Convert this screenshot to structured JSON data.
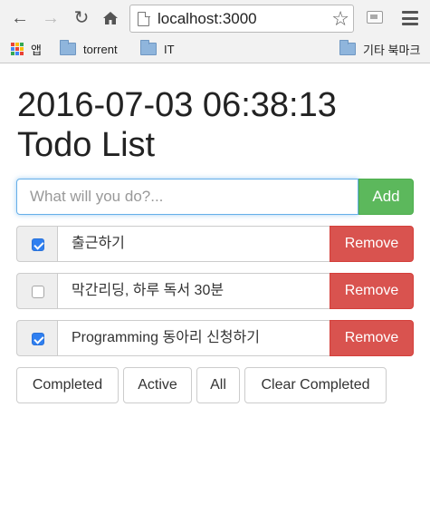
{
  "browser": {
    "url": "localhost:3000",
    "bookmarks": [
      {
        "label": "앱",
        "icon": "apps-grid-icon"
      },
      {
        "label": "torrent",
        "icon": "folder-icon"
      },
      {
        "label": "IT",
        "icon": "folder-icon"
      },
      {
        "label": "기타 북마크",
        "icon": "folder-icon"
      }
    ]
  },
  "app": {
    "title_line1": "2016-07-03 06:38:13",
    "title_line2": "Todo List",
    "input_placeholder": "What will you do?...",
    "input_value": "",
    "add_label": "Add",
    "remove_label": "Remove",
    "todos": [
      {
        "text": "출근하기",
        "completed": true
      },
      {
        "text": "막간리딩, 하루 독서 30분",
        "completed": false
      },
      {
        "text": "Programming 동아리 신청하기",
        "completed": true
      }
    ],
    "filters": [
      "Completed",
      "Active",
      "All",
      "Clear Completed"
    ]
  },
  "colors": {
    "add_button": "#5cb85c",
    "remove_button": "#d9534f",
    "checkbox_checked": "#2f7ff0",
    "input_focus": "#66afe9"
  }
}
